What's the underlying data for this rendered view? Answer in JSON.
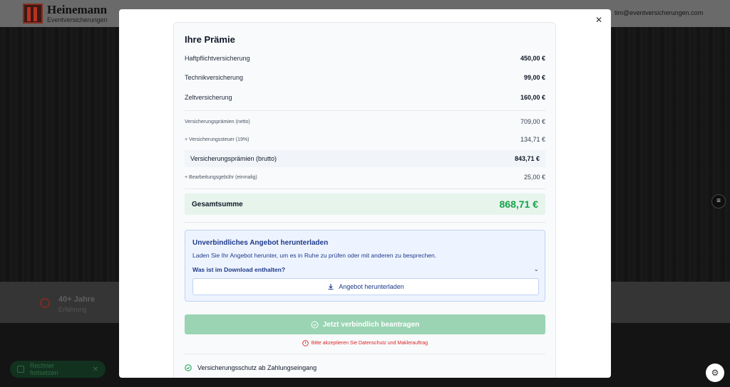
{
  "background": {
    "logo": {
      "name": "Heinemann",
      "sub": "Eventversicherungen"
    },
    "email": "tim@eventversicherungen.com",
    "badge": {
      "title": "40+ Jahre",
      "subtitle": "Erfahrung"
    },
    "pill": {
      "label": "Rechner fortsetzen"
    }
  },
  "modal": {
    "title": "Ihre Prämie",
    "items": [
      {
        "label": "Haftpflichtversicherung",
        "value": "450,00 €"
      },
      {
        "label": "Technikversicherung",
        "value": "99,00 €"
      },
      {
        "label": "Zeltversicherung",
        "value": "160,00 €"
      }
    ],
    "netto": {
      "label": "Versicherungsprämien (netto)",
      "value": "709,00 €"
    },
    "tax": {
      "label": "+ Versicherungssteuer (19%)",
      "value": "134,71 €"
    },
    "brutto": {
      "label": "Versicherungsprämien (brutto)",
      "value": "843,71 €"
    },
    "fee": {
      "label": "+ Bearbeitungsgebühr (einmalig)",
      "value": "25,00 €"
    },
    "total": {
      "label": "Gesamtsumme",
      "value": "868,71 €"
    },
    "download": {
      "title": "Unverbindliches Angebot herunterladen",
      "description": "Laden Sie Ihr Angebot herunter, um es in Ruhe zu prüfen oder mit anderen zu besprechen.",
      "expander": "Was ist im Download enthalten?",
      "button": "Angebot herunterladen"
    },
    "submit": "Jetzt verbindlich beantragen",
    "warning": "Bitte akzeptieren Sie Datenschutz und Maklerauftrag",
    "feature": "Versicherungsschutz ab Zahlungseingang"
  },
  "colors": {
    "total_accent": "#16a34a",
    "submit_bg": "#9ad4b3",
    "warning": "#dc2626",
    "info_text": "#1e3a8a"
  }
}
